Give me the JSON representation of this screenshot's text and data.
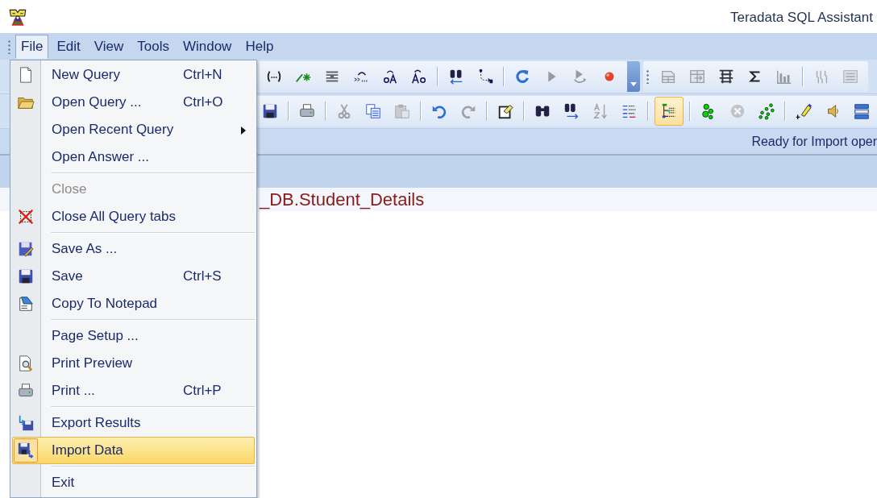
{
  "window": {
    "title": "Teradata SQL Assistant"
  },
  "menubar": [
    {
      "label": "File",
      "selected": true
    },
    {
      "label": "Edit",
      "selected": false
    },
    {
      "label": "View",
      "selected": false
    },
    {
      "label": "Tools",
      "selected": false
    },
    {
      "label": "Window",
      "selected": false
    },
    {
      "label": "Help",
      "selected": false
    }
  ],
  "toolbar_rows": [
    {
      "toolbars": [
        {
          "overflow": true,
          "groups": [
            [
              {
                "disabled": false,
                "selected": false
              },
              {
                "disabled": false,
                "selected": false
              },
              {
                "disabled": false,
                "selected": false
              },
              {
                "disabled": false,
                "selected": false
              },
              {
                "disabled": false,
                "selected": false
              },
              {
                "disabled": false,
                "selected": false
              }
            ],
            [
              {
                "disabled": false,
                "selected": false
              },
              {
                "disabled": false,
                "selected": false
              }
            ],
            [
              {
                "disabled": false,
                "selected": false
              },
              {
                "disabled": true,
                "selected": false
              },
              {
                "disabled": true,
                "selected": false
              },
              {
                "disabled": false,
                "selected": false
              }
            ]
          ]
        },
        {
          "groups": [
            [
              {
                "disabled": true,
                "selected": false
              },
              {
                "disabled": true,
                "selected": false
              },
              {
                "disabled": false,
                "selected": false
              },
              {
                "disabled": false,
                "selected": false
              },
              {
                "disabled": true,
                "selected": false
              }
            ],
            [
              {
                "disabled": true,
                "selected": false
              },
              {
                "disabled": true,
                "selected": false
              }
            ]
          ]
        }
      ]
    },
    {
      "toolbars": [
        {
          "groups": [
            [
              {
                "disabled": false,
                "selected": false
              }
            ],
            [
              {
                "disabled": false,
                "selected": false
              }
            ],
            [
              {
                "disabled": true,
                "selected": false
              },
              {
                "disabled": false,
                "selected": false
              },
              {
                "disabled": true,
                "selected": false
              }
            ],
            [
              {
                "disabled": false,
                "selected": false
              },
              {
                "disabled": true,
                "selected": false
              }
            ],
            [
              {
                "disabled": false,
                "selected": false
              }
            ],
            [
              {
                "disabled": false,
                "selected": false
              },
              {
                "disabled": false,
                "selected": false
              },
              {
                "disabled": true,
                "selected": false
              },
              {
                "disabled": false,
                "selected": false
              }
            ],
            [
              {
                "disabled": false,
                "selected": true
              }
            ],
            [
              {
                "disabled": false,
                "selected": false
              },
              {
                "disabled": true,
                "selected": false
              },
              {
                "disabled": false,
                "selected": false
              }
            ],
            [
              {
                "disabled": false,
                "selected": false
              },
              {
                "disabled": false,
                "selected": false
              },
              {
                "disabled": false,
                "selected": false
              }
            ]
          ]
        }
      ]
    }
  ],
  "status": "Ready for Import oper",
  "query_text": "_DB.Student_Details",
  "file_menu": {
    "groups": [
      [
        {
          "label": "New Query",
          "shortcut": "Ctrl+N",
          "disabled": false,
          "selected": false
        },
        {
          "label": "Open Query ...",
          "shortcut": "Ctrl+O",
          "disabled": false,
          "selected": false
        },
        {
          "label": "Open Recent Query",
          "disabled": false,
          "selected": false,
          "submenu": true
        },
        {
          "label": "Open Answer ...",
          "disabled": false,
          "selected": false
        }
      ],
      [
        {
          "label": "Close",
          "disabled": true,
          "selected": false
        },
        {
          "label": "Close All Query tabs",
          "disabled": false,
          "selected": false
        }
      ],
      [
        {
          "label": "Save As ...",
          "disabled": false,
          "selected": false
        },
        {
          "label": "Save",
          "shortcut": "Ctrl+S",
          "disabled": false,
          "selected": false
        },
        {
          "label": "Copy To Notepad",
          "disabled": false,
          "selected": false
        }
      ],
      [
        {
          "label": "Page Setup ...",
          "disabled": false,
          "selected": false
        },
        {
          "label": "Print Preview",
          "disabled": false,
          "selected": false
        },
        {
          "label": "Print ...",
          "shortcut": "Ctrl+P",
          "disabled": false,
          "selected": false
        }
      ],
      [
        {
          "label": "Export Results",
          "disabled": false,
          "selected": false
        },
        {
          "label": "Import Data",
          "disabled": false,
          "selected": true
        }
      ],
      [
        {
          "label": "Exit",
          "disabled": false,
          "selected": false
        }
      ]
    ]
  }
}
